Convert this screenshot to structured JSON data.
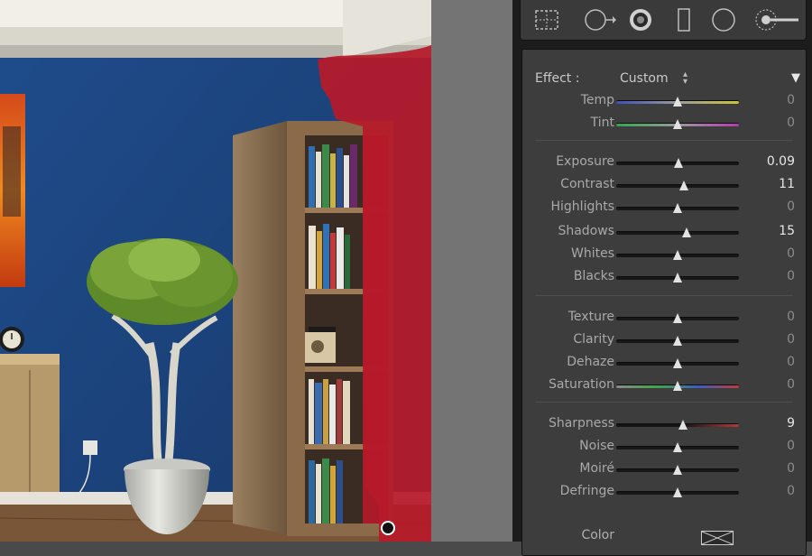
{
  "toolbar": {
    "tools": [
      {
        "icon": "crop-overlay-icon",
        "label": "Crop Overlay"
      },
      {
        "icon": "spot-removal-icon",
        "label": "Spot Removal"
      },
      {
        "icon": "red-eye-icon",
        "label": "Red Eye Correction"
      },
      {
        "icon": "graduated-filter-icon",
        "label": "Graduated Filter"
      },
      {
        "icon": "radial-filter-icon",
        "label": "Radial Filter"
      },
      {
        "icon": "adjustment-brush-icon",
        "label": "Adjustment Brush"
      }
    ]
  },
  "effect": {
    "label": "Effect :",
    "value": "Custom",
    "stepper_icon": "up-down-stepper-icon",
    "collapse_icon": "triangle-down-icon"
  },
  "groups": [
    [
      {
        "name": "Temp",
        "value": "0",
        "track": "temp",
        "pos": 0.5,
        "active": false
      },
      {
        "name": "Tint",
        "value": "0",
        "track": "tint",
        "pos": 0.5,
        "active": false
      }
    ],
    [
      {
        "name": "Exposure",
        "value": "0.09",
        "track": "plain",
        "pos": 0.51,
        "active": true
      },
      {
        "name": "Contrast",
        "value": "11",
        "track": "plain",
        "pos": 0.555,
        "active": true
      },
      {
        "name": "Highlights",
        "value": "0",
        "track": "plain",
        "pos": 0.5,
        "active": false
      },
      {
        "name": "Shadows",
        "value": "15",
        "track": "plain",
        "pos": 0.575,
        "active": true
      },
      {
        "name": "Whites",
        "value": "0",
        "track": "plain",
        "pos": 0.5,
        "active": false
      },
      {
        "name": "Blacks",
        "value": "0",
        "track": "plain",
        "pos": 0.5,
        "active": false
      }
    ],
    [
      {
        "name": "Texture",
        "value": "0",
        "track": "plain",
        "pos": 0.5,
        "active": false
      },
      {
        "name": "Clarity",
        "value": "0",
        "track": "plain",
        "pos": 0.5,
        "active": false
      },
      {
        "name": "Dehaze",
        "value": "0",
        "track": "plain",
        "pos": 0.5,
        "active": false
      },
      {
        "name": "Saturation",
        "value": "0",
        "track": "saturation",
        "pos": 0.5,
        "active": false
      }
    ],
    [
      {
        "name": "Sharpness",
        "value": "9",
        "track": "sharpness",
        "pos": 0.545,
        "active": true
      },
      {
        "name": "Noise",
        "value": "0",
        "track": "plain",
        "pos": 0.5,
        "active": false
      },
      {
        "name": "Moiré",
        "value": "0",
        "track": "plain",
        "pos": 0.5,
        "active": false
      },
      {
        "name": "Defringe",
        "value": "0",
        "track": "plain",
        "pos": 0.5,
        "active": false
      }
    ]
  ],
  "color": {
    "label": "Color",
    "swatch_icon": "no-color-swatch-icon"
  },
  "colors": {
    "wall": "#244c86",
    "mask_overlay": "#b71a2a",
    "panel_bg": "#3d3d3d",
    "thumb": "#e2e2e2"
  }
}
